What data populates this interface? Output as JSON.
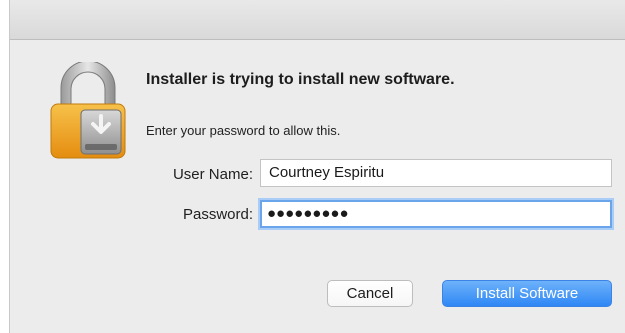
{
  "dialog": {
    "headline": "Installer is trying to install new software.",
    "subtext": "Enter your password to allow this.",
    "icon": "lock-with-installer-icon"
  },
  "form": {
    "username_label": "User Name:",
    "username_value": "Courtney Espiritu",
    "password_label": "Password:",
    "password_value": "●●●●●●●●●"
  },
  "buttons": {
    "cancel_label": "Cancel",
    "install_label": "Install Software"
  },
  "colors": {
    "accent": "#3a8ef6",
    "focus_ring": "#a9cdf7",
    "lock_gold": "#f2a922"
  }
}
